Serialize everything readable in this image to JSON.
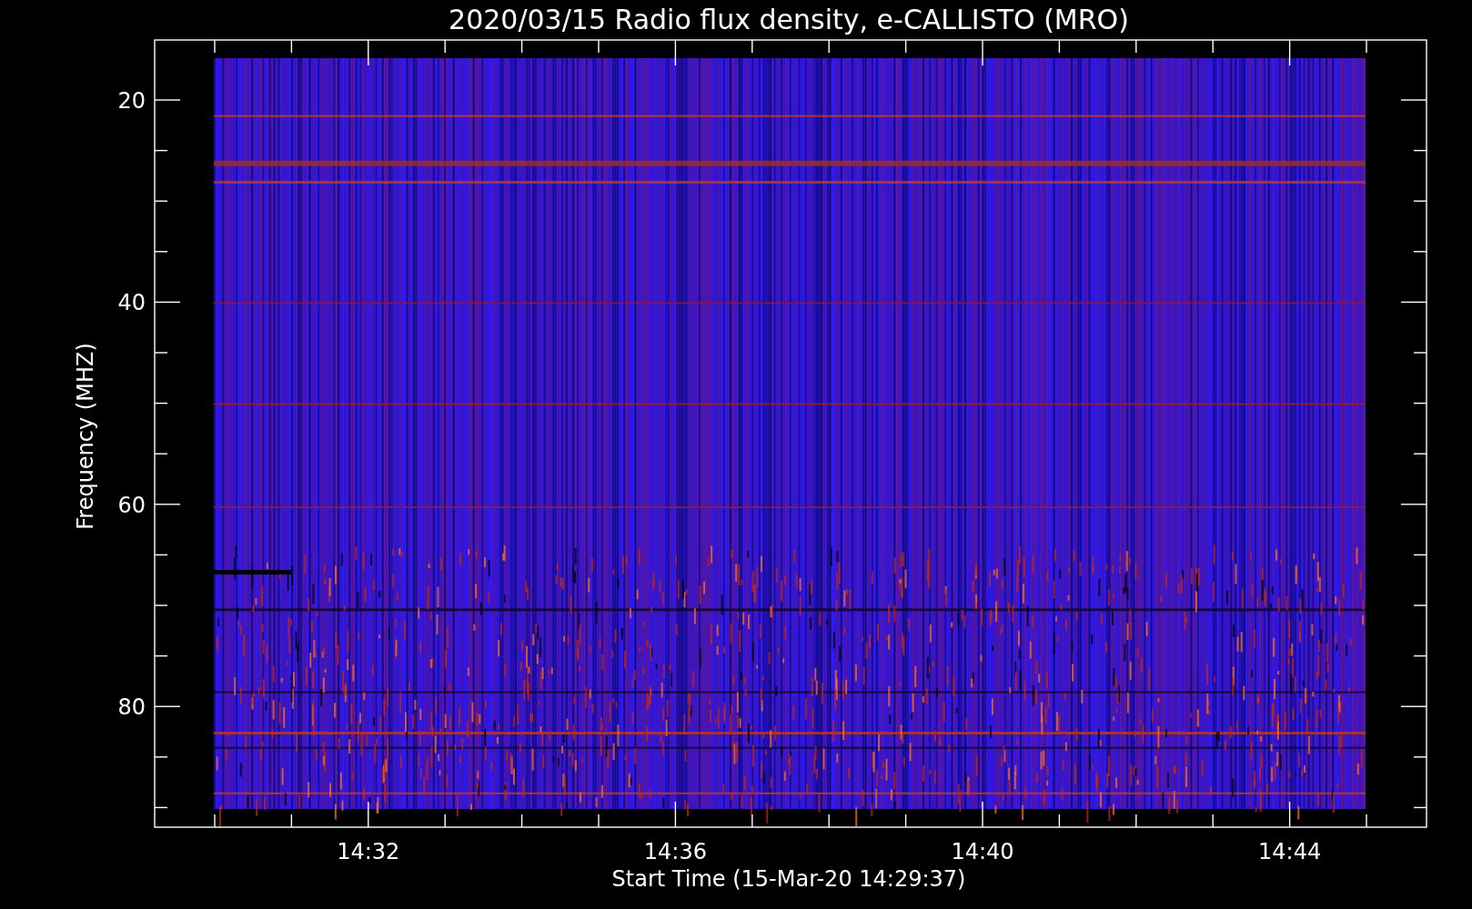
{
  "title": "2020/03/15  Radio flux density, e-CALLISTO (MRO)",
  "y_axis": {
    "label": "Frequency (MHZ)",
    "ticks": [
      "20",
      "40",
      "60",
      "80"
    ]
  },
  "x_axis": {
    "label": "Start Time (15-Mar-20 14:29:37)",
    "ticks": [
      "14:32",
      "14:36",
      "14:40",
      "14:44"
    ]
  }
}
